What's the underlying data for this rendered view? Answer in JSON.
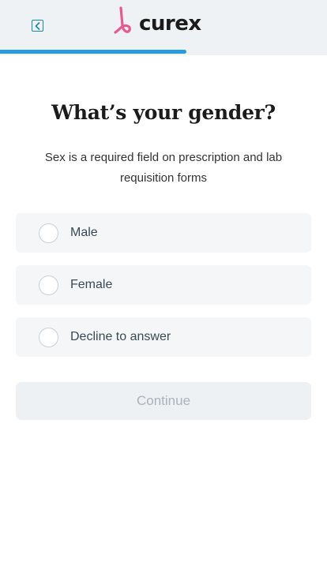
{
  "header": {
    "back_icon": "back-arrow-icon",
    "logo_text": "curex",
    "logo_mark_icon": "curex-logo-mark",
    "accent_color": "#e75a8c",
    "progress": 0.57,
    "progress_color": "#2a9ae0"
  },
  "main": {
    "title": "What’s your gender?",
    "subtitle": "Sex is a required field on prescription and lab requisition forms",
    "options": [
      {
        "label": "Male",
        "selected": false
      },
      {
        "label": "Female",
        "selected": false
      },
      {
        "label": "Decline to answer",
        "selected": false
      }
    ],
    "continue_label": "Continue",
    "continue_enabled": false
  }
}
